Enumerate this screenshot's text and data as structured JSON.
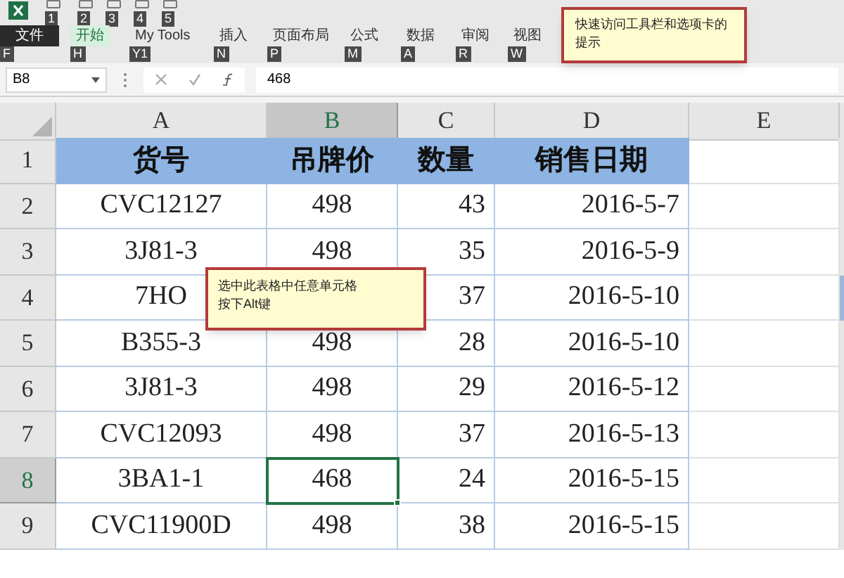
{
  "quick_access": [
    {
      "keytip": "1"
    },
    {
      "keytip": "2"
    },
    {
      "keytip": "3"
    },
    {
      "keytip": "4"
    },
    {
      "keytip": "5"
    }
  ],
  "tabs": [
    {
      "label": "文件",
      "keytip": "F",
      "kind": "file",
      "selected": false
    },
    {
      "label": "开始",
      "keytip": "H",
      "kind": "tab",
      "selected": true
    },
    {
      "label": "My Tools",
      "keytip": "Y1",
      "kind": "tab",
      "selected": false
    },
    {
      "label": "插入",
      "keytip": "N",
      "kind": "tab",
      "selected": false
    },
    {
      "label": "页面布局",
      "keytip": "P",
      "kind": "tab",
      "selected": false
    },
    {
      "label": "公式",
      "keytip": "M",
      "kind": "tab",
      "selected": false
    },
    {
      "label": "数据",
      "keytip": "A",
      "kind": "tab",
      "selected": false
    },
    {
      "label": "审阅",
      "keytip": "R",
      "kind": "tab",
      "selected": false
    },
    {
      "label": "视图",
      "keytip": "W",
      "kind": "tab",
      "selected": false
    }
  ],
  "ribbon_tooltip": "快速访问工具栏和选项卡的提示",
  "formula_bar": {
    "name_box": "B8",
    "value": "468"
  },
  "sheet": {
    "columns": [
      {
        "label": "A",
        "selected": false
      },
      {
        "label": "B",
        "selected": true
      },
      {
        "label": "C",
        "selected": false
      },
      {
        "label": "D",
        "selected": false
      },
      {
        "label": "E",
        "selected": false
      }
    ],
    "rows": [
      {
        "label": "1",
        "kind": "header",
        "selected": false,
        "cells": [
          "货号",
          "吊牌价",
          "数量",
          "销售日期",
          null
        ]
      },
      {
        "label": "2",
        "kind": "data",
        "selected": false,
        "cells": [
          "CVC12127",
          "498",
          "43",
          "2016-5-7",
          null
        ]
      },
      {
        "label": "3",
        "kind": "data",
        "selected": false,
        "cells": [
          "3J81-3",
          "498",
          "35",
          "2016-5-9",
          null
        ]
      },
      {
        "label": "4",
        "kind": "data",
        "selected": false,
        "cells": [
          "7HO",
          null,
          "37",
          "2016-5-10",
          null
        ]
      },
      {
        "label": "5",
        "kind": "data",
        "selected": false,
        "cells": [
          "B355-3",
          "498",
          "28",
          "2016-5-10",
          null
        ]
      },
      {
        "label": "6",
        "kind": "data",
        "selected": false,
        "cells": [
          "3J81-3",
          "498",
          "29",
          "2016-5-12",
          null
        ]
      },
      {
        "label": "7",
        "kind": "data",
        "selected": false,
        "cells": [
          "CVC12093",
          "498",
          "37",
          "2016-5-13",
          null
        ]
      },
      {
        "label": "8",
        "kind": "data",
        "selected": true,
        "cells": [
          "3BA1-1",
          "468",
          "24",
          "2016-5-15",
          null
        ]
      },
      {
        "label": "9",
        "kind": "data",
        "selected": false,
        "cells": [
          "CVC11900D",
          "498",
          "38",
          "2016-5-15",
          null
        ]
      }
    ]
  },
  "cell_tooltip": [
    "选中此表格中任意单元格",
    "按下Alt键"
  ]
}
